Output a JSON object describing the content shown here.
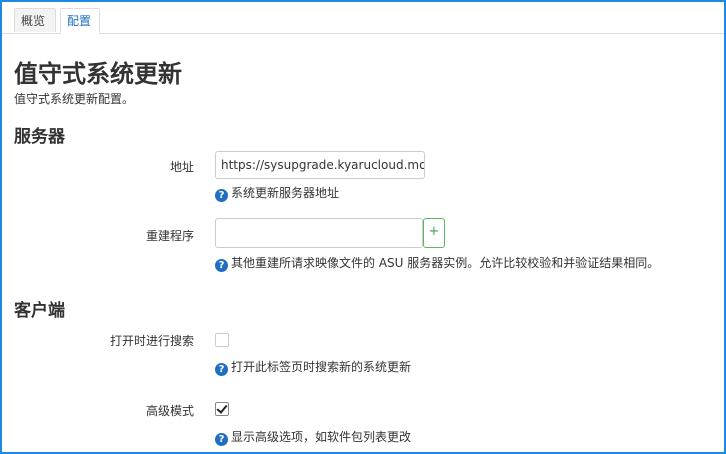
{
  "tabs": [
    {
      "label": "概览"
    },
    {
      "label": "配置"
    }
  ],
  "page": {
    "title": "值守式系统更新",
    "subtitle": "值守式系统更新配置。"
  },
  "server_section": {
    "title": "服务器",
    "address": {
      "label": "地址",
      "value": "https://sysupgrade.kyarucloud.moe",
      "help": "系统更新服务器地址"
    },
    "rebuilders": {
      "label": "重建程序",
      "value": "",
      "add_label": "+",
      "help": "其他重建所请求映像文件的 ASU 服务器实例。允许比较校验和并验证结果相同。"
    }
  },
  "client_section": {
    "title": "客户端",
    "auto_search": {
      "label": "打开时进行搜索",
      "checked": false,
      "help": "打开此标签页时搜索新的系统更新"
    },
    "advanced_mode": {
      "label": "高级模式",
      "checked": true,
      "help": "显示高级选项，如软件包列表更改"
    }
  },
  "help_icon": "question-circle-icon",
  "colors": {
    "accent": "#1e6fc2",
    "add_button_border": "#5cb85c",
    "frame": "#1e88e5"
  }
}
